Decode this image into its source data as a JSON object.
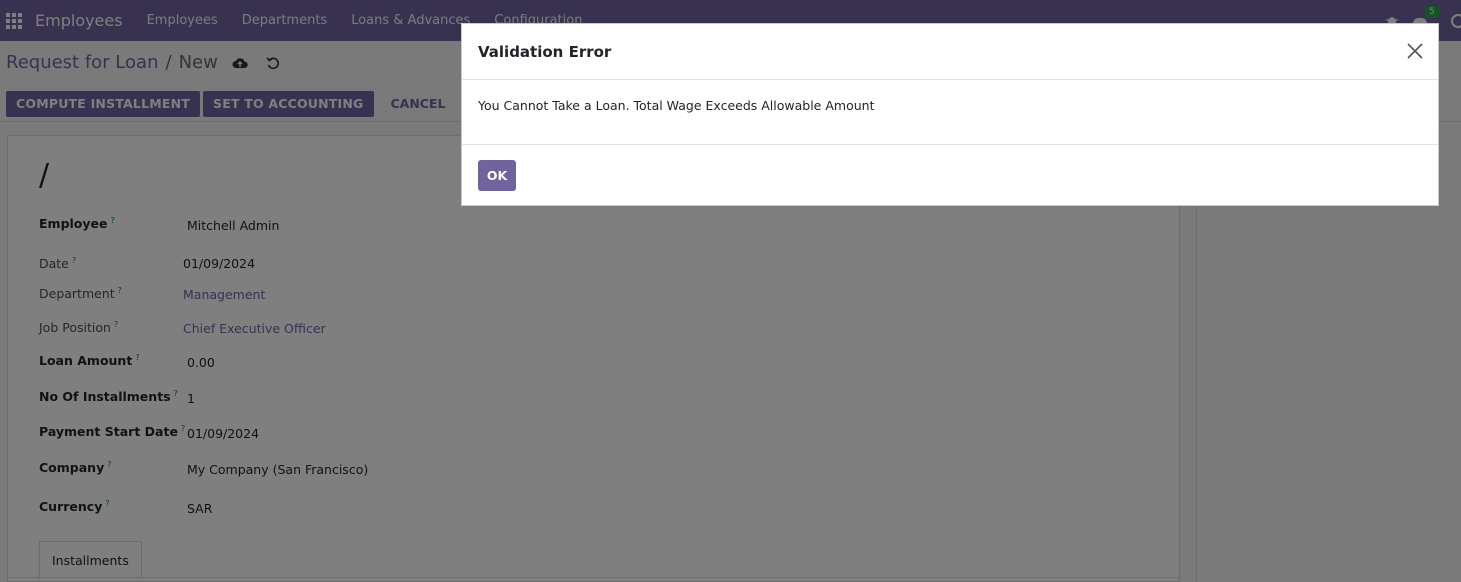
{
  "navbar": {
    "brand": "Employees",
    "menu": [
      "Employees",
      "Departments",
      "Loans & Advances",
      "Configuration"
    ],
    "chat_badge": "5",
    "color": "#71639e"
  },
  "breadcrumb": {
    "parent": "Request for Loan",
    "separator": "/",
    "current": "New"
  },
  "toolbar": {
    "compute_label": "COMPUTE INSTALLMENT",
    "accounting_label": "SET TO ACCOUNTING",
    "cancel_label": "CANCEL"
  },
  "form": {
    "name": "/",
    "fields": {
      "employee": {
        "label": "Employee",
        "value": "Mitchell Admin"
      },
      "date": {
        "label": "Date",
        "value": "01/09/2024"
      },
      "department": {
        "label": "Department",
        "value": "Management"
      },
      "job_position": {
        "label": "Job Position",
        "value": "Chief Executive Officer"
      },
      "loan_amount": {
        "label": "Loan Amount",
        "value": "0.00"
      },
      "installments": {
        "label": "No Of Installments",
        "value": "1"
      },
      "payment_start": {
        "label": "Payment Start Date",
        "value": "01/09/2024"
      },
      "company": {
        "label": "Company",
        "value": "My Company (San Francisco)"
      },
      "currency": {
        "label": "Currency",
        "value": "SAR"
      }
    },
    "help_marker": "?",
    "tab": "Installments"
  },
  "dialog": {
    "title": "Validation Error",
    "message": "You Cannot Take a Loan. Total Wage Exceeds Allowable Amount",
    "ok_label": "OK"
  }
}
